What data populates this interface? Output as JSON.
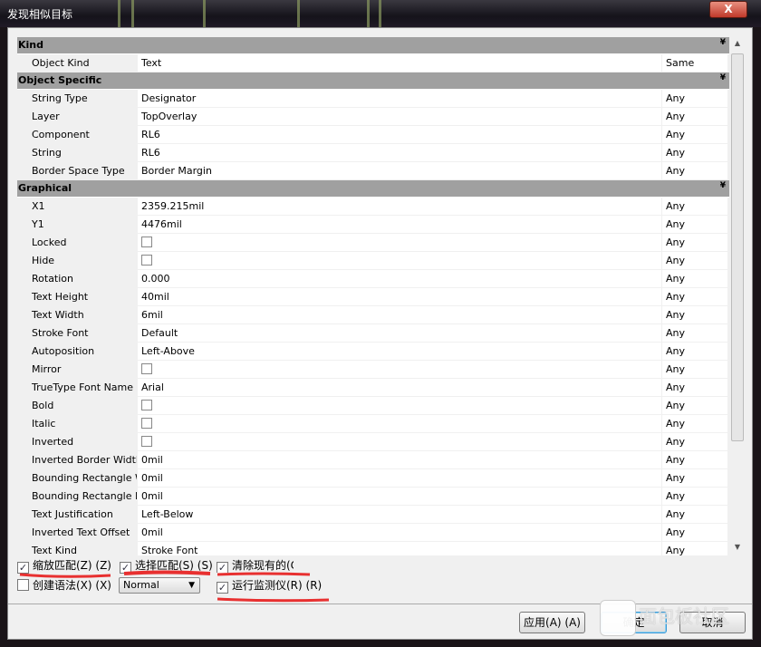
{
  "window": {
    "title": "发现相似目标",
    "close_label": "X"
  },
  "sections": [
    {
      "title": "Kind",
      "rows": [
        {
          "name": "Object Kind",
          "value": "Text",
          "match": "Same"
        }
      ]
    },
    {
      "title": "Object Specific",
      "rows": [
        {
          "name": "String Type",
          "value": "Designator",
          "match": "Any"
        },
        {
          "name": "Layer",
          "value": "TopOverlay",
          "match": "Any"
        },
        {
          "name": "Component",
          "value": "RL6",
          "match": "Any"
        },
        {
          "name": "String",
          "value": "RL6",
          "match": "Any"
        },
        {
          "name": "Border Space Type",
          "value": "Border Margin",
          "match": "Any"
        }
      ]
    },
    {
      "title": "Graphical",
      "rows": [
        {
          "name": "X1",
          "value": "2359.215mil",
          "match": "Any"
        },
        {
          "name": "Y1",
          "value": "4476mil",
          "match": "Any"
        },
        {
          "name": "Locked",
          "value": "",
          "checkbox": true,
          "match": "Any"
        },
        {
          "name": "Hide",
          "value": "",
          "checkbox": true,
          "match": "Any"
        },
        {
          "name": "Rotation",
          "value": "0.000",
          "match": "Any"
        },
        {
          "name": "Text Height",
          "value": "40mil",
          "match": "Any"
        },
        {
          "name": "Text Width",
          "value": "6mil",
          "match": "Any"
        },
        {
          "name": "Stroke Font",
          "value": "Default",
          "match": "Any"
        },
        {
          "name": "Autoposition",
          "value": "Left-Above",
          "match": "Any"
        },
        {
          "name": "Mirror",
          "value": "",
          "checkbox": true,
          "match": "Any"
        },
        {
          "name": "TrueType Font Name",
          "value": "Arial",
          "match": "Any"
        },
        {
          "name": "Bold",
          "value": "",
          "checkbox": true,
          "match": "Any"
        },
        {
          "name": "Italic",
          "value": "",
          "checkbox": true,
          "match": "Any"
        },
        {
          "name": "Inverted",
          "value": "",
          "checkbox": true,
          "match": "Any"
        },
        {
          "name": "Inverted Border Width",
          "value": "0mil",
          "match": "Any"
        },
        {
          "name": "Bounding Rectangle W",
          "value": "0mil",
          "match": "Any"
        },
        {
          "name": "Bounding Rectangle H",
          "value": "0mil",
          "match": "Any"
        },
        {
          "name": "Text Justification",
          "value": "Left-Below",
          "match": "Any"
        },
        {
          "name": "Inverted Text Offset",
          "value": "0mil",
          "match": "Any"
        },
        {
          "name": "Text Kind",
          "value": "Stroke Font",
          "match": "Any"
        }
      ]
    }
  ],
  "options": {
    "zoom_matching": {
      "label": "缩放匹配(Z) (Z)",
      "checked": true
    },
    "select_matching": {
      "label": "选择匹配(S) (S)",
      "checked": true
    },
    "clear_existing": {
      "label": "清除现有的(C",
      "checked": true
    },
    "create_expression": {
      "label": "创建语法(X) (X)",
      "checked": false
    },
    "run_inspector": {
      "label": "运行监测仪(R) (R)",
      "checked": true
    },
    "mask_mode": "Normal"
  },
  "buttons": {
    "apply": "应用(A) (A)",
    "ok": "确定",
    "cancel": "取消"
  },
  "watermark": "面包板社区",
  "colors": {
    "section_header": "#a0a0a0",
    "annotation": "#e83030"
  }
}
